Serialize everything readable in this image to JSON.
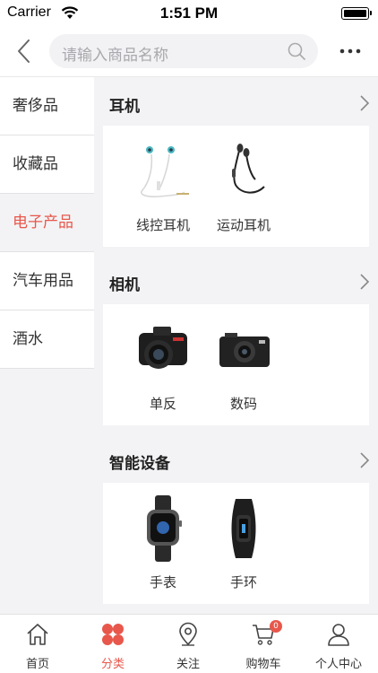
{
  "status_bar": {
    "carrier": "Carrier",
    "time": "1:51 PM"
  },
  "search": {
    "placeholder": "请输入商品名称"
  },
  "sidebar": {
    "items": [
      {
        "label": "奢侈品"
      },
      {
        "label": "收藏品"
      },
      {
        "label": "电子产品",
        "active": true
      },
      {
        "label": "汽车用品"
      },
      {
        "label": "酒水"
      }
    ]
  },
  "sections": [
    {
      "title": "耳机",
      "products": [
        {
          "label": "线控耳机",
          "icon": "wired-earphones-image"
        },
        {
          "label": "运动耳机",
          "icon": "sport-earphones-image"
        }
      ]
    },
    {
      "title": "相机",
      "products": [
        {
          "label": "单反",
          "icon": "dslr-camera-image"
        },
        {
          "label": "数码",
          "icon": "digital-camera-image"
        }
      ]
    },
    {
      "title": "智能设备",
      "products": [
        {
          "label": "手表",
          "icon": "smartwatch-image"
        },
        {
          "label": "手环",
          "icon": "fitness-band-image"
        }
      ]
    }
  ],
  "tabbar": {
    "items": [
      {
        "label": "首页",
        "icon": "home-icon"
      },
      {
        "label": "分类",
        "icon": "category-icon",
        "active": true
      },
      {
        "label": "关注",
        "icon": "location-pin-icon"
      },
      {
        "label": "购物车",
        "icon": "cart-icon",
        "badge": "0"
      },
      {
        "label": "个人中心",
        "icon": "user-icon"
      }
    ]
  },
  "colors": {
    "accent": "#e8574b",
    "background": "#f3f3f5"
  }
}
